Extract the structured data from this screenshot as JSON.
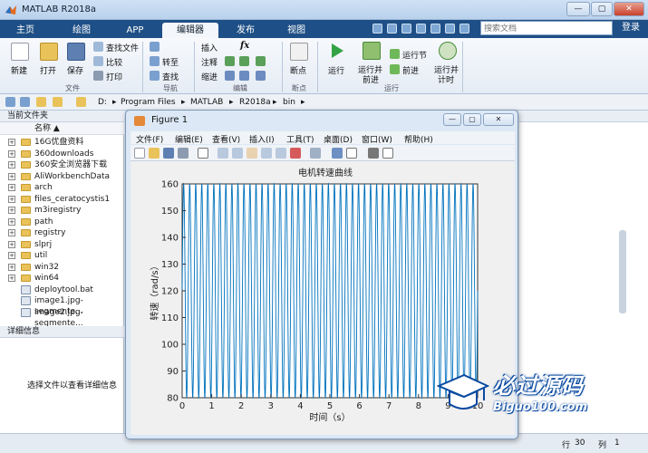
{
  "app": {
    "title": "MATLAB R2018a",
    "window_buttons": [
      "—",
      "▢",
      "✕"
    ]
  },
  "ribbon_tabs": [
    "主页",
    "绘图",
    "APP",
    "编辑器",
    "发布",
    "视图"
  ],
  "search": {
    "placeholder": "搜索文档"
  },
  "login_label": "登录",
  "ribbon": {
    "file": {
      "new": "新建",
      "open": "打开",
      "save": "保存",
      "find_files": "查找文件",
      "compare": "比较",
      "print": "打印",
      "group": "文件"
    },
    "navigate": {
      "goto": "转至",
      "find": "查找",
      "group": "导航"
    },
    "edit": {
      "insert": "插入",
      "comment": "注释",
      "indent": "缩进",
      "fx": "fx",
      "group": "编辑"
    },
    "breakpoints": {
      "breakpoint": "断点",
      "group": "断点"
    },
    "run": {
      "run": "运行",
      "run_advance_1": "运行并",
      "run_advance_2": "前进",
      "run_section": "运行节",
      "advance": "前进",
      "run_time_1": "运行并",
      "run_time_2": "计时",
      "group": "运行"
    }
  },
  "address": {
    "path": [
      "D:",
      "Program Files",
      "MATLAB",
      "R2018a",
      "bin"
    ]
  },
  "current_folder": {
    "title": "当前文件夹",
    "column": "名称 ▲",
    "items": [
      {
        "name": "16G优盘资料",
        "type": "folder"
      },
      {
        "name": "360downloads",
        "type": "folder"
      },
      {
        "name": "360安全浏览器下载",
        "type": "folder"
      },
      {
        "name": "AliWorkbenchData",
        "type": "folder"
      },
      {
        "name": "arch",
        "type": "folder"
      },
      {
        "name": "files_ceratocystis1",
        "type": "folder"
      },
      {
        "name": "m3iregistry",
        "type": "folder"
      },
      {
        "name": "path",
        "type": "folder"
      },
      {
        "name": "registry",
        "type": "folder"
      },
      {
        "name": "slprj",
        "type": "folder"
      },
      {
        "name": "util",
        "type": "folder"
      },
      {
        "name": "win32",
        "type": "folder"
      },
      {
        "name": "win64",
        "type": "folder"
      },
      {
        "name": "deploytool.bat",
        "type": "file"
      },
      {
        "name": "image1.jpg-segmente...",
        "type": "file"
      },
      {
        "name": "image2.jpg-segmente...",
        "type": "file"
      }
    ]
  },
  "details": {
    "title": "详细信息",
    "message": "选择文件以查看详细信息"
  },
  "status": {
    "col_label": "行",
    "line": "30",
    "col_word": "列",
    "col": "1"
  },
  "figure": {
    "title": "Figure 1",
    "menu": [
      "文件(F)",
      "编辑(E)",
      "查看(V)",
      "插入(I)",
      "工具(T)",
      "桌面(D)",
      "窗口(W)",
      "帮助(H)"
    ]
  },
  "watermark": {
    "title": "必过源码",
    "subtitle": "Biguo100.com"
  },
  "chart_data": {
    "type": "line",
    "title": "电机转速曲线",
    "xlabel": "时间（s）",
    "ylabel": "转速（rad/s）",
    "xlim": [
      0,
      10
    ],
    "ylim": [
      80,
      160
    ],
    "xticks": [
      0,
      1,
      2,
      3,
      4,
      5,
      6,
      7,
      8,
      9,
      10
    ],
    "yticks": [
      80,
      90,
      100,
      110,
      120,
      130,
      140,
      150,
      160
    ],
    "grid": false,
    "series": [
      {
        "color": "#0072bd",
        "function": "sine",
        "amplitude": 40,
        "offset": 120,
        "frequency_hz": 4.9,
        "x_range": [
          0,
          10
        ]
      }
    ]
  }
}
